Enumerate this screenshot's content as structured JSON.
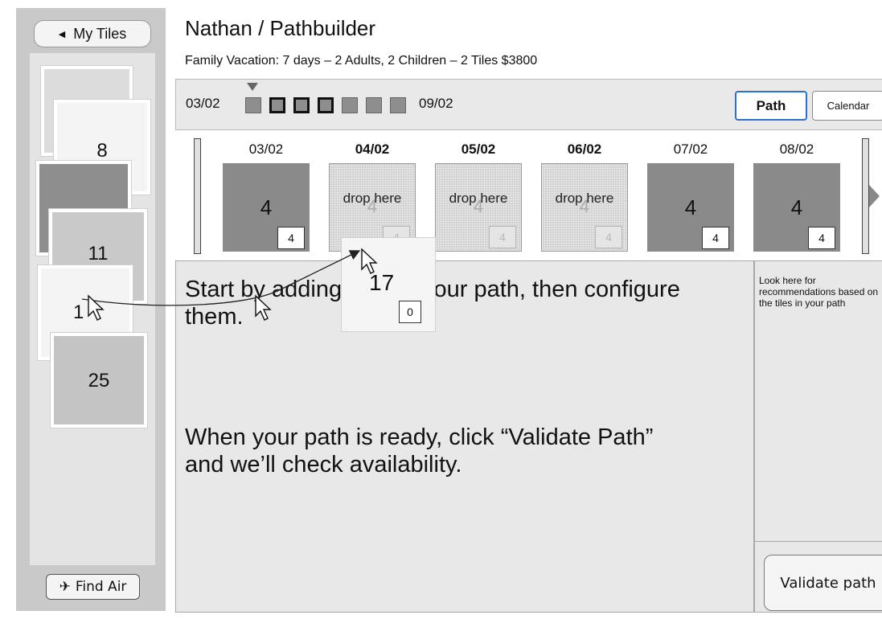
{
  "sidebar": {
    "back_label": "My Tiles",
    "back_icon": "triangle-left-icon",
    "tiles": [
      "8",
      "11",
      "1",
      "25"
    ],
    "find_air_label": "Find Air",
    "find_air_icon": "airplane-icon"
  },
  "header": {
    "title": "Nathan / Pathbuilder",
    "subtitle": "Family Vacation:  7 days – 2 Adults, 2 Children – 2 Tiles $3800"
  },
  "timeline": {
    "start": "03/02",
    "end": "09/02",
    "path_label": "Path",
    "calendar_label": "Calendar"
  },
  "days": [
    {
      "date": "03/02",
      "state": "filled",
      "value": "4",
      "count": "4"
    },
    {
      "date": "04/02",
      "state": "drop",
      "label": "drop here",
      "ghost": "4",
      "count": "4"
    },
    {
      "date": "05/02",
      "state": "drop",
      "label": "drop here",
      "ghost": "4",
      "count": "4"
    },
    {
      "date": "06/02",
      "state": "drop",
      "label": "drop here",
      "ghost": "4",
      "count": "4"
    },
    {
      "date": "07/02",
      "state": "filled",
      "value": "4",
      "count": "4"
    },
    {
      "date": "08/02",
      "state": "filled",
      "value": "4",
      "count": "4"
    }
  ],
  "main": {
    "intro_line1": "Start by adding tiles to your path, then configure them.",
    "intro_line2": "When your path is ready, click “Validate Path” and we’ll check availability."
  },
  "recommendations": {
    "text": "Look here for recommendations based on the tiles in your path",
    "validate_label": "Validate path"
  },
  "drag_tile": {
    "value": "17",
    "count": "0"
  }
}
